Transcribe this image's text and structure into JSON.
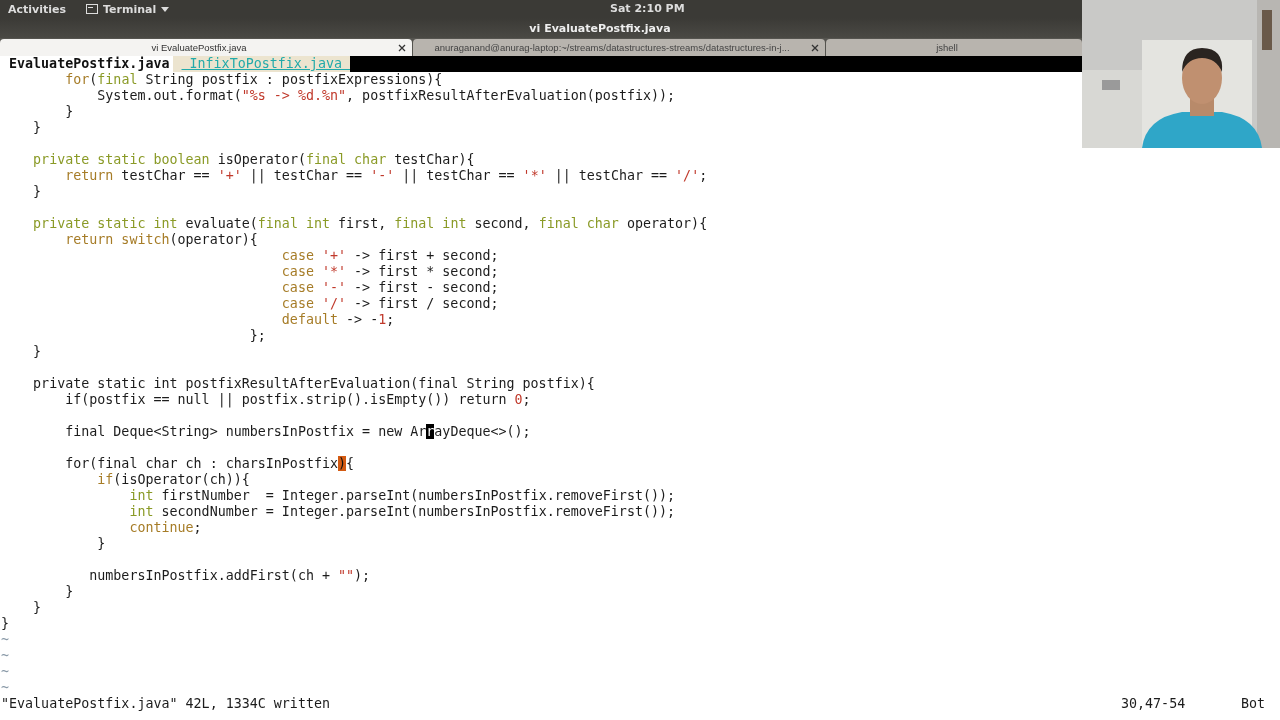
{
  "top_bar": {
    "activities": "Activities",
    "app_menu": "Terminal",
    "clock": "Sat 2:10 PM"
  },
  "window": {
    "title": "vi EvaluatePostfix.java"
  },
  "tabs": [
    {
      "label": "vi EvaluatePostfix.java",
      "selected": true,
      "closable": true
    },
    {
      "label": "anuraganand@anurag-laptop:~/streams/datastructures-streams/datastructures-in-j...",
      "selected": false,
      "closable": true
    },
    {
      "label": "jshell",
      "selected": false,
      "closable": false
    }
  ],
  "buffers": [
    {
      "label": "EvaluatePostfix.java",
      "selected": true
    },
    {
      "label": " InfixToPostfix.java ",
      "selected": false
    }
  ],
  "code_lines": [
    {
      "kind": "code",
      "tokens": [
        {
          "kind": "stmt",
          "t": "        for"
        },
        {
          "kind": "plain",
          "t": "("
        },
        {
          "kind": "type",
          "t": "final"
        },
        {
          "kind": "plain",
          "t": " String postfix : postfixExpressions){"
        }
      ]
    },
    {
      "kind": "code",
      "tokens": [
        {
          "kind": "plain",
          "t": "            System.out.format("
        },
        {
          "kind": "str",
          "t": "\"%s -> %d.%n\""
        },
        {
          "kind": "plain",
          "t": ", postfixResultAfterEvaluation(postfix));"
        }
      ]
    },
    {
      "kind": "code",
      "tokens": [
        {
          "kind": "plain",
          "t": "        }"
        }
      ]
    },
    {
      "kind": "code",
      "tokens": [
        {
          "kind": "plain",
          "t": "    }"
        }
      ]
    },
    {
      "kind": "blank"
    },
    {
      "kind": "code",
      "tokens": [
        {
          "kind": "type",
          "t": "    private static boolean"
        },
        {
          "kind": "plain",
          "t": " isOperator("
        },
        {
          "kind": "type",
          "t": "final char"
        },
        {
          "kind": "plain",
          "t": " testChar){"
        }
      ]
    },
    {
      "kind": "code",
      "tokens": [
        {
          "kind": "stmt",
          "t": "        return"
        },
        {
          "kind": "plain",
          "t": " testChar == "
        },
        {
          "kind": "str",
          "t": "'+'"
        },
        {
          "kind": "plain",
          "t": " || testChar == "
        },
        {
          "kind": "str",
          "t": "'-'"
        },
        {
          "kind": "plain",
          "t": " || testChar == "
        },
        {
          "kind": "str",
          "t": "'*'"
        },
        {
          "kind": "plain",
          "t": " || testChar == "
        },
        {
          "kind": "str",
          "t": "'/'"
        },
        {
          "kind": "plain",
          "t": ";"
        }
      ]
    },
    {
      "kind": "code",
      "tokens": [
        {
          "kind": "plain",
          "t": "    }"
        }
      ]
    },
    {
      "kind": "blank"
    },
    {
      "kind": "code",
      "tokens": [
        {
          "kind": "type",
          "t": "    private static int"
        },
        {
          "kind": "plain",
          "t": " evaluate("
        },
        {
          "kind": "type",
          "t": "final int"
        },
        {
          "kind": "plain",
          "t": " first, "
        },
        {
          "kind": "type",
          "t": "final int"
        },
        {
          "kind": "plain",
          "t": " second, "
        },
        {
          "kind": "type",
          "t": "final char"
        },
        {
          "kind": "plain",
          "t": " operator){"
        }
      ]
    },
    {
      "kind": "code",
      "tokens": [
        {
          "kind": "stmt",
          "t": "        return switch"
        },
        {
          "kind": "plain",
          "t": "(operator){"
        }
      ]
    },
    {
      "kind": "code",
      "tokens": [
        {
          "kind": "stmt",
          "t": "                                   case "
        },
        {
          "kind": "str",
          "t": "'+'"
        },
        {
          "kind": "plain",
          "t": " -> first + second;"
        }
      ]
    },
    {
      "kind": "code",
      "tokens": [
        {
          "kind": "stmt",
          "t": "                                   case "
        },
        {
          "kind": "str",
          "t": "'*'"
        },
        {
          "kind": "plain",
          "t": " -> first * second;"
        }
      ]
    },
    {
      "kind": "code",
      "tokens": [
        {
          "kind": "stmt",
          "t": "                                   case "
        },
        {
          "kind": "str",
          "t": "'-'"
        },
        {
          "kind": "plain",
          "t": " -> first - second;"
        }
      ]
    },
    {
      "kind": "code",
      "tokens": [
        {
          "kind": "stmt",
          "t": "                                   case "
        },
        {
          "kind": "str",
          "t": "'/'"
        },
        {
          "kind": "plain",
          "t": " -> first / second;"
        }
      ]
    },
    {
      "kind": "code",
      "tokens": [
        {
          "kind": "stmt",
          "t": "                                   default"
        },
        {
          "kind": "plain",
          "t": " -> -"
        },
        {
          "kind": "str",
          "t": "1"
        },
        {
          "kind": "plain",
          "t": ";"
        }
      ]
    },
    {
      "kind": "code",
      "tokens": [
        {
          "kind": "plain",
          "t": "                               };"
        }
      ]
    },
    {
      "kind": "code",
      "tokens": [
        {
          "kind": "plain",
          "t": "    }"
        }
      ]
    },
    {
      "kind": "blank"
    },
    {
      "kind": "code",
      "tokens": [
        {
          "kind": "plain",
          "t": "    private static int postfixResultAfterEvaluation(final String postfix){"
        }
      ]
    },
    {
      "kind": "code",
      "tokens": [
        {
          "kind": "plain",
          "t": "        if(postfix == null || postfix.strip().isEmpty()) return "
        },
        {
          "kind": "str",
          "t": "0"
        },
        {
          "kind": "plain",
          "t": ";"
        }
      ]
    },
    {
      "kind": "blank"
    },
    {
      "kind": "code",
      "tokens": [
        {
          "kind": "plain",
          "t": "        final Deque<String> numbersInPostfix = new Ar"
        },
        {
          "kind": "cursor",
          "t": "r"
        },
        {
          "kind": "plain",
          "t": "ayDeque<>();"
        }
      ]
    },
    {
      "kind": "blank"
    },
    {
      "kind": "code",
      "tokens": [
        {
          "kind": "plain",
          "t": "        for(final char ch : charsInPostfix"
        },
        {
          "kind": "match",
          "t": ")"
        },
        {
          "kind": "plain",
          "t": "{"
        }
      ]
    },
    {
      "kind": "code",
      "tokens": [
        {
          "kind": "stmt",
          "t": "            if"
        },
        {
          "kind": "plain",
          "t": "(isOperator(ch)){"
        }
      ]
    },
    {
      "kind": "code",
      "tokens": [
        {
          "kind": "type",
          "t": "                int"
        },
        {
          "kind": "plain",
          "t": " firstNumber  = Integer.parseInt(numbersInPostfix.removeFirst());"
        }
      ]
    },
    {
      "kind": "code",
      "tokens": [
        {
          "kind": "type",
          "t": "                int"
        },
        {
          "kind": "plain",
          "t": " secondNumber = Integer.parseInt(numbersInPostfix.removeFirst());"
        }
      ]
    },
    {
      "kind": "code",
      "tokens": [
        {
          "kind": "stmt",
          "t": "                continue"
        },
        {
          "kind": "plain",
          "t": ";"
        }
      ]
    },
    {
      "kind": "code",
      "tokens": [
        {
          "kind": "plain",
          "t": "            }"
        }
      ]
    },
    {
      "kind": "blank"
    },
    {
      "kind": "code",
      "tokens": [
        {
          "kind": "plain",
          "t": "           numbersInPostfix.addFirst(ch + "
        },
        {
          "kind": "str",
          "t": "\"\""
        },
        {
          "kind": "plain",
          "t": ");"
        }
      ]
    },
    {
      "kind": "code",
      "tokens": [
        {
          "kind": "plain",
          "t": "        }"
        }
      ]
    },
    {
      "kind": "code",
      "tokens": [
        {
          "kind": "plain",
          "t": "    }"
        }
      ]
    },
    {
      "kind": "code",
      "tokens": [
        {
          "kind": "plain",
          "t": "}"
        }
      ]
    }
  ],
  "tilde_lines": [
    "~",
    "~",
    "~",
    "~"
  ],
  "status_line": {
    "message": "\"EvaluatePostfix.java\" 42L, 1334C written",
    "position": "30,47-54",
    "scroll": "Bot"
  }
}
